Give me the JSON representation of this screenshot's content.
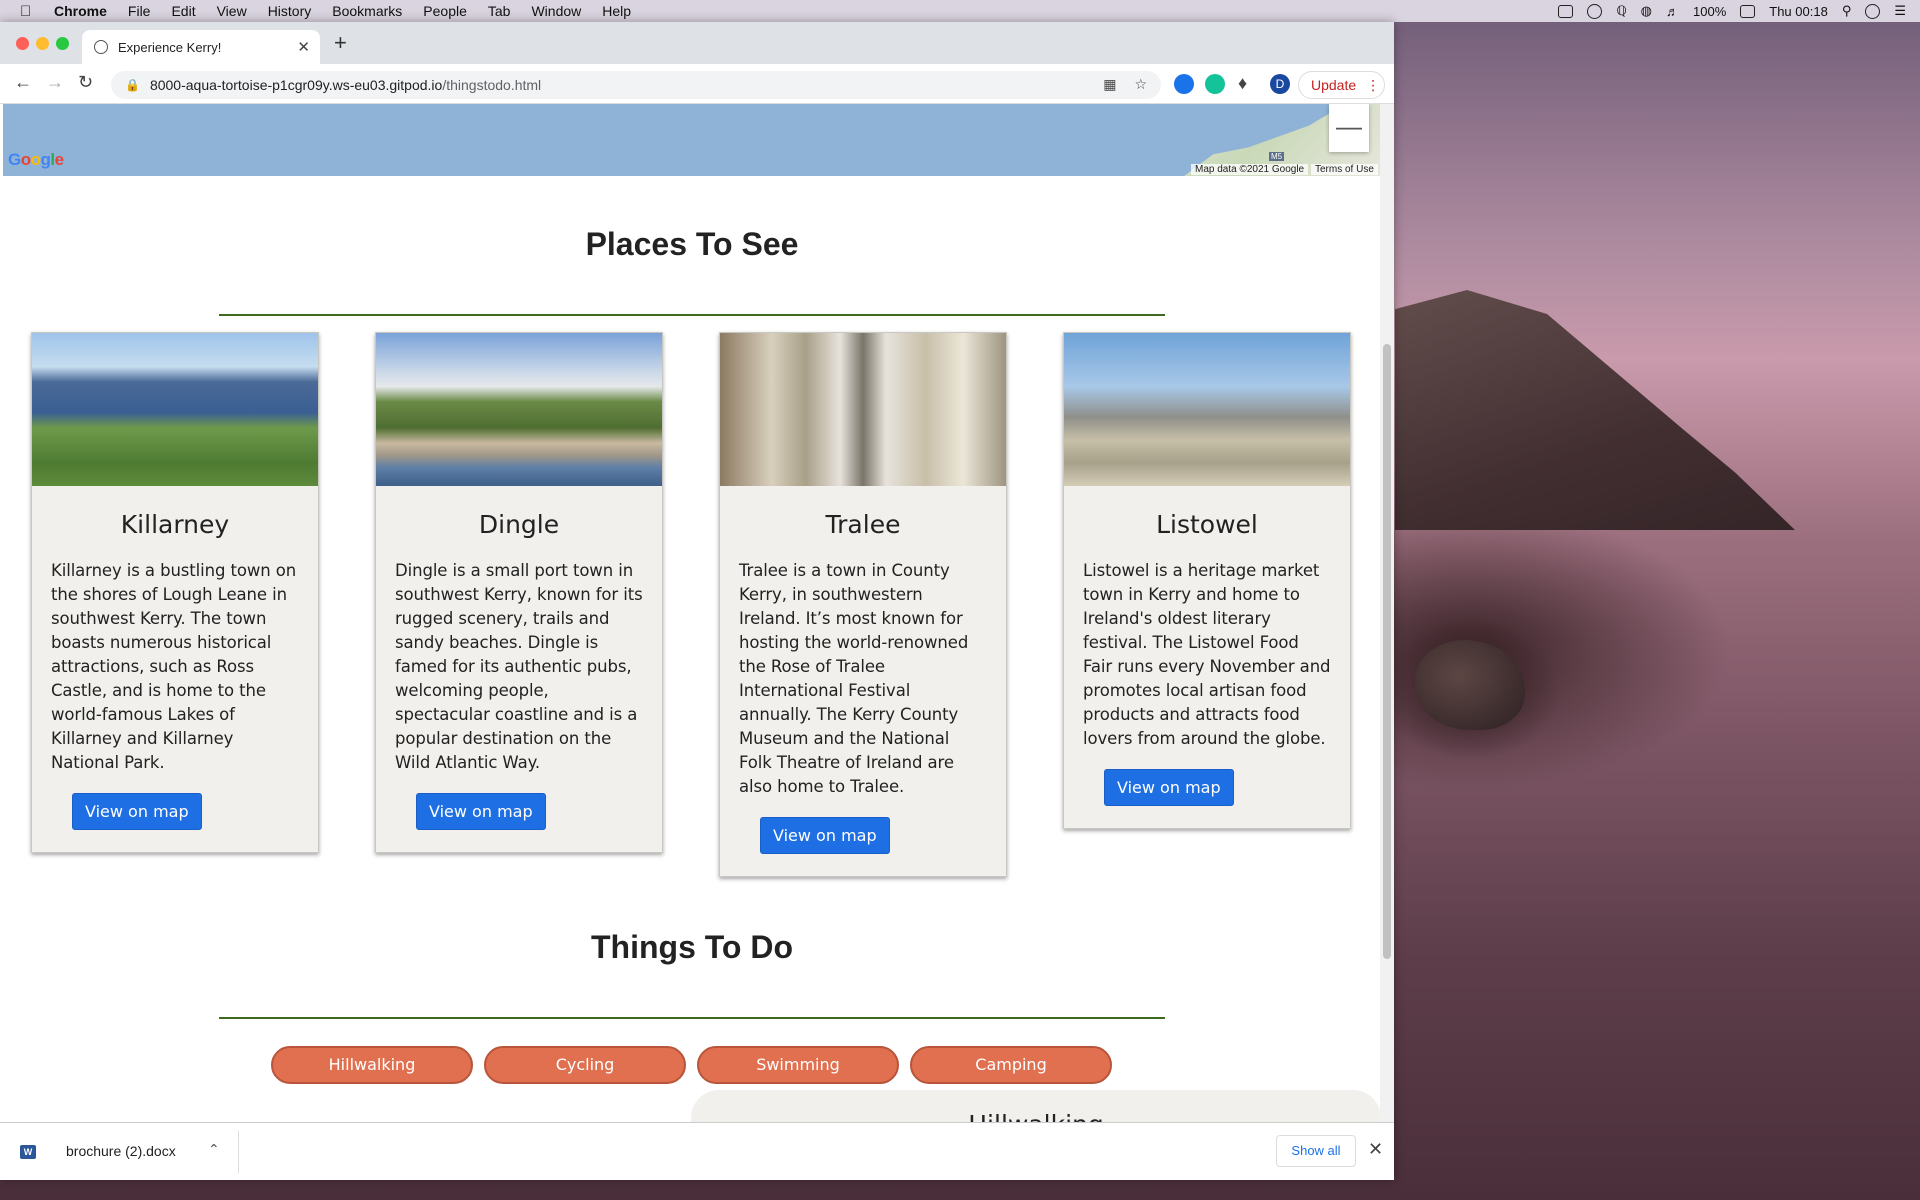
{
  "menubar": {
    "app": "Chrome",
    "items": [
      "File",
      "Edit",
      "View",
      "History",
      "Bookmarks",
      "People",
      "Tab",
      "Window",
      "Help"
    ],
    "battery": "100%",
    "clock": "Thu 00:18"
  },
  "browser": {
    "tab_title": "Experience Kerry!",
    "url_host": "8000-aqua-tortoise-p1cgr09y.ws-eu03.gitpod.io",
    "url_path": "/thingstodo.html",
    "profile_initial": "D",
    "update_label": "Update"
  },
  "map": {
    "logo": "Google",
    "attribution": "Map data ©2021 Google",
    "terms": "Terms of Use",
    "road_label": "M5"
  },
  "places": {
    "title": "Places To See",
    "cards": [
      {
        "name": "Killarney",
        "description": "Killarney is a bustling town on the shores of Lough Leane in southwest Kerry. The town boasts numerous historical attractions, such as Ross Castle, and is home to the world-famous Lakes of Killarney and Killarney National Park.",
        "button": "View on map"
      },
      {
        "name": "Dingle",
        "description": "Dingle is a small port town in southwest Kerry, known for its rugged scenery, trails and sandy beaches. Dingle is famed for its authentic pubs, welcoming people, spectacular coastline and is a popular destination on the Wild Atlantic Way.",
        "button": "View on map"
      },
      {
        "name": "Tralee",
        "description": "Tralee is a town in County Kerry, in southwestern Ireland. It’s most known for hosting the world-renowned the Rose of Tralee International Festival annually. The Kerry County Museum and the National Folk Theatre of Ireland are also home to Tralee.",
        "button": "View on map"
      },
      {
        "name": "Listowel",
        "description": "Listowel is a heritage market town in Kerry and home to Ireland's oldest literary festival. The Listowel Food Fair runs every November and promotes local artisan food products and attracts food lovers from around the globe.",
        "button": "View on map"
      }
    ]
  },
  "things": {
    "title": "Things To Do",
    "activities": [
      "Hillwalking",
      "Cycling",
      "Swimming",
      "Camping"
    ],
    "active_card_title": "Hillwalking"
  },
  "downloads": {
    "file_name": "brochure (2).docx",
    "show_all": "Show all"
  }
}
